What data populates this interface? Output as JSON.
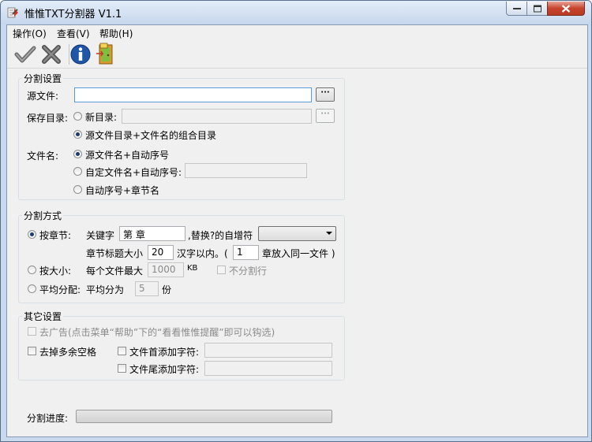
{
  "window": {
    "title": "惟惟TXT分割器 V1.1"
  },
  "menu": {
    "items": [
      "操作(O)",
      "查看(V)",
      "帮助(H)"
    ]
  },
  "toolbar": {
    "buttons": [
      "check-icon",
      "x-icon",
      "info-icon",
      "exit-door-icon"
    ]
  },
  "split_settings": {
    "title": "分割设置",
    "source_label": "源文件:",
    "source_value": "",
    "browse_label": "···",
    "save_dir_label": "保存目录:",
    "new_dir_label": "新目录:",
    "new_dir_value": "",
    "combo_dir_label": "源文件目录+文件名的组合目录",
    "filename_label": "文件名:",
    "opt_auto_seq": "源文件名+自动序号",
    "opt_custom": "自定文件名+自动序号:",
    "custom_value": "",
    "opt_chapter": "自动序号+章节名"
  },
  "split_method": {
    "title": "分割方式",
    "by_chapter_label": "按章节:",
    "keyword_label": "关键字",
    "keyword_value": "第  章",
    "replace_label": ",替换?的自增符",
    "replace_value": "",
    "title_max_label": "章节标题大小",
    "title_max_value": "20",
    "chars_within_label": "汉字以内。(",
    "chapters_value": "1",
    "chapters_into_label": "章放入同一文件 )",
    "by_size_label": "按大小:",
    "max_each_label": "每个文件最大",
    "max_size_value": "1000",
    "kb_label": "KB",
    "no_split_line_label": "不分割行",
    "average_label": "平均分配:",
    "average_into_label": "平均分为",
    "average_value": "5",
    "parts_label": "份"
  },
  "other_settings": {
    "title": "其它设置",
    "remove_ads_label": "去广告(点击菜单“帮助”下的“看看惟惟提醒”即可以钩选)",
    "remove_spaces_label": "去掉多余空格",
    "prepend_label": "文件首添加字符:",
    "prepend_value": "",
    "append_label": "文件尾添加字符:",
    "append_value": ""
  },
  "progress": {
    "label": "分割进度:",
    "value": 0
  },
  "colors": {
    "titlebar": "#d5e3f4",
    "close_button": "#c7432d",
    "radio_dot": "#1b3b6e"
  }
}
